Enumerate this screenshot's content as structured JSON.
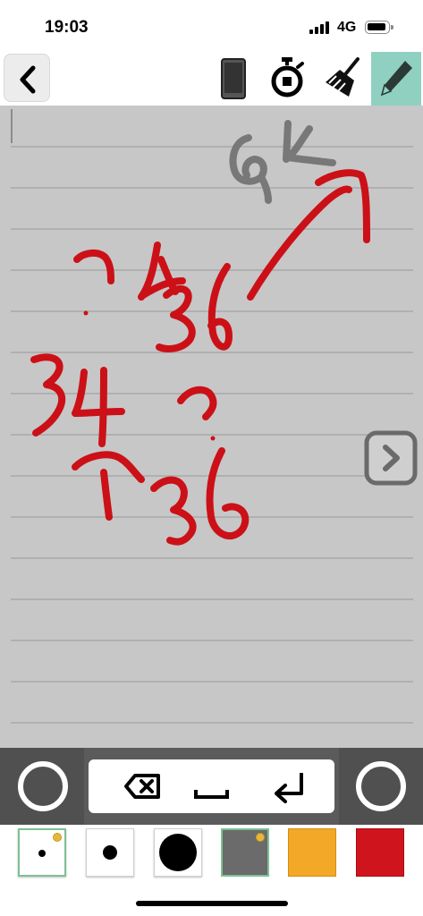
{
  "status_bar": {
    "time": "19:03",
    "network": "4G",
    "signal_bars": 4,
    "battery_level": 0.8
  },
  "toolbar": {
    "back_icon": "chevron-left-icon",
    "tools": [
      "phone-icon",
      "stopwatch-icon",
      "broom-icon",
      "pencil-icon"
    ],
    "selected_tool": "pencil-icon",
    "selected_tool_color": "#8fd0c0"
  },
  "canvas": {
    "background": "#c7c7c7",
    "rule_line_color": "#a8a8a8",
    "ink_colors": {
      "red": "#cc1017",
      "gray": "#787878"
    },
    "handwritten_text": [
      "6k",
      "?",
      "4",
      "36",
      "34",
      "?",
      "1",
      "36"
    ],
    "next_page_icon": "chevron-right-icon"
  },
  "input_bar": {
    "left_button_icon": "circle-icon",
    "right_button_icon": "circle-icon",
    "keys": [
      "backspace-icon",
      "space-icon",
      "return-icon"
    ]
  },
  "palette": {
    "swatches": [
      {
        "kind": "pen-size-small",
        "color": "#ffffff",
        "selected": true
      },
      {
        "kind": "pen-size-medium",
        "color": "#ffffff",
        "selected": false
      },
      {
        "kind": "pen-size-large",
        "color": "#ffffff",
        "selected": false
      },
      {
        "kind": "color-gray",
        "color": "#6b6b6b",
        "selected": true
      },
      {
        "kind": "color-orange",
        "color": "#f3a827",
        "selected": false
      },
      {
        "kind": "color-red",
        "color": "#d0141d",
        "selected": false
      }
    ]
  }
}
